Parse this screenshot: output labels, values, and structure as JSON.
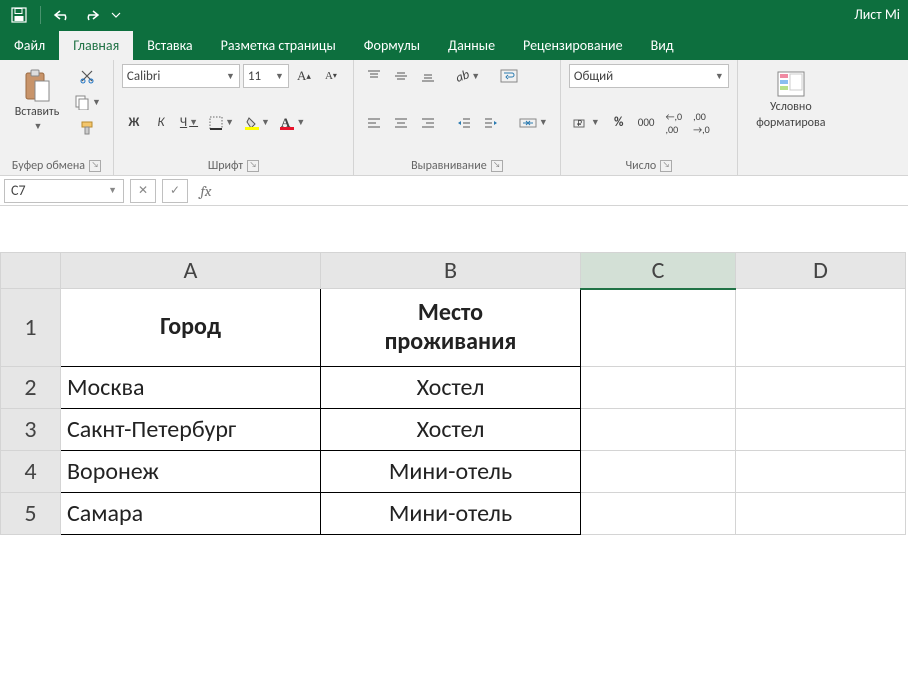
{
  "title_suffix": "Лист Mi",
  "tabs": {
    "file": "Файл",
    "home": "Главная",
    "insert": "Вставка",
    "layout": "Разметка страницы",
    "formulas": "Формулы",
    "data": "Данные",
    "review": "Рецензирование",
    "view": "Вид"
  },
  "ribbon": {
    "clipboard": {
      "paste": "Вставить",
      "label": "Буфер обмена"
    },
    "font": {
      "name": "Calibri",
      "size": "11",
      "bold": "Ж",
      "italic": "К",
      "underline": "Ч",
      "label": "Шрифт"
    },
    "alignment": {
      "label": "Выравнивание"
    },
    "number": {
      "format": "Общий",
      "label": "Число"
    },
    "styles": {
      "cond": "Условно",
      "cond2": "форматирова"
    }
  },
  "namebox": "C7",
  "formula_bar": {
    "cancel": "✕",
    "confirm": "✓",
    "fx": "fx",
    "value": ""
  },
  "columns": [
    "A",
    "B",
    "C",
    "D"
  ],
  "rows": [
    "1",
    "2",
    "3",
    "4",
    "5"
  ],
  "table": {
    "headers": {
      "a": "Город",
      "b1": "Место",
      "b2": "проживания"
    },
    "data": [
      {
        "a": "Москва",
        "b": "Хостел"
      },
      {
        "a": "Сакнт-Петербург",
        "b": "Хостел"
      },
      {
        "a": "Воронеж",
        "b": "Мини-отель"
      },
      {
        "a": "Самара",
        "b": "Мини-отель"
      }
    ]
  }
}
